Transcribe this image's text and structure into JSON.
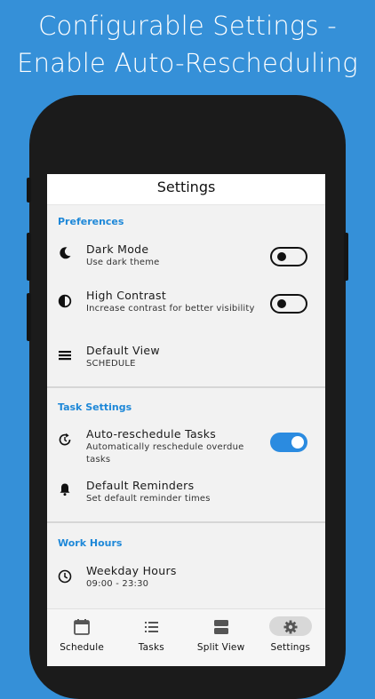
{
  "headline": {
    "line1": "Configurable Settings -",
    "line2": "Enable Auto-Rescheduling"
  },
  "appbar": {
    "title": "Settings"
  },
  "sections": {
    "preferences": {
      "title": "Preferences",
      "dark_mode": {
        "title": "Dark Mode",
        "subtitle": "Use dark theme",
        "enabled": false,
        "icon": "moon-icon"
      },
      "high_contrast": {
        "title": "High Contrast",
        "subtitle": "Increase contrast for better visibility",
        "enabled": false,
        "icon": "contrast-icon"
      },
      "default_view": {
        "title": "Default View",
        "subtitle": "SCHEDULE",
        "icon": "view-icon"
      }
    },
    "task_settings": {
      "title": "Task Settings",
      "auto_reschedule": {
        "title": "Auto-reschedule Tasks",
        "subtitle": "Automatically reschedule overdue tasks",
        "enabled": true,
        "icon": "reschedule-icon"
      },
      "default_reminders": {
        "title": "Default Reminders",
        "subtitle": "Set default reminder times",
        "icon": "bell-icon"
      }
    },
    "work_hours": {
      "title": "Work Hours",
      "weekday_hours": {
        "title": "Weekday Hours",
        "subtitle": "09:00 - 23:30",
        "icon": "clock-icon"
      }
    }
  },
  "bottom_nav": {
    "items": [
      {
        "label": "Schedule",
        "icon": "calendar-icon"
      },
      {
        "label": "Tasks",
        "icon": "list-icon"
      },
      {
        "label": "Split View",
        "icon": "split-view-icon"
      },
      {
        "label": "Settings",
        "icon": "gear-icon",
        "active": true
      }
    ]
  },
  "colors": {
    "background": "#3590d8",
    "accent": "#1e88d8",
    "toggle_on": "#2b8be0"
  }
}
